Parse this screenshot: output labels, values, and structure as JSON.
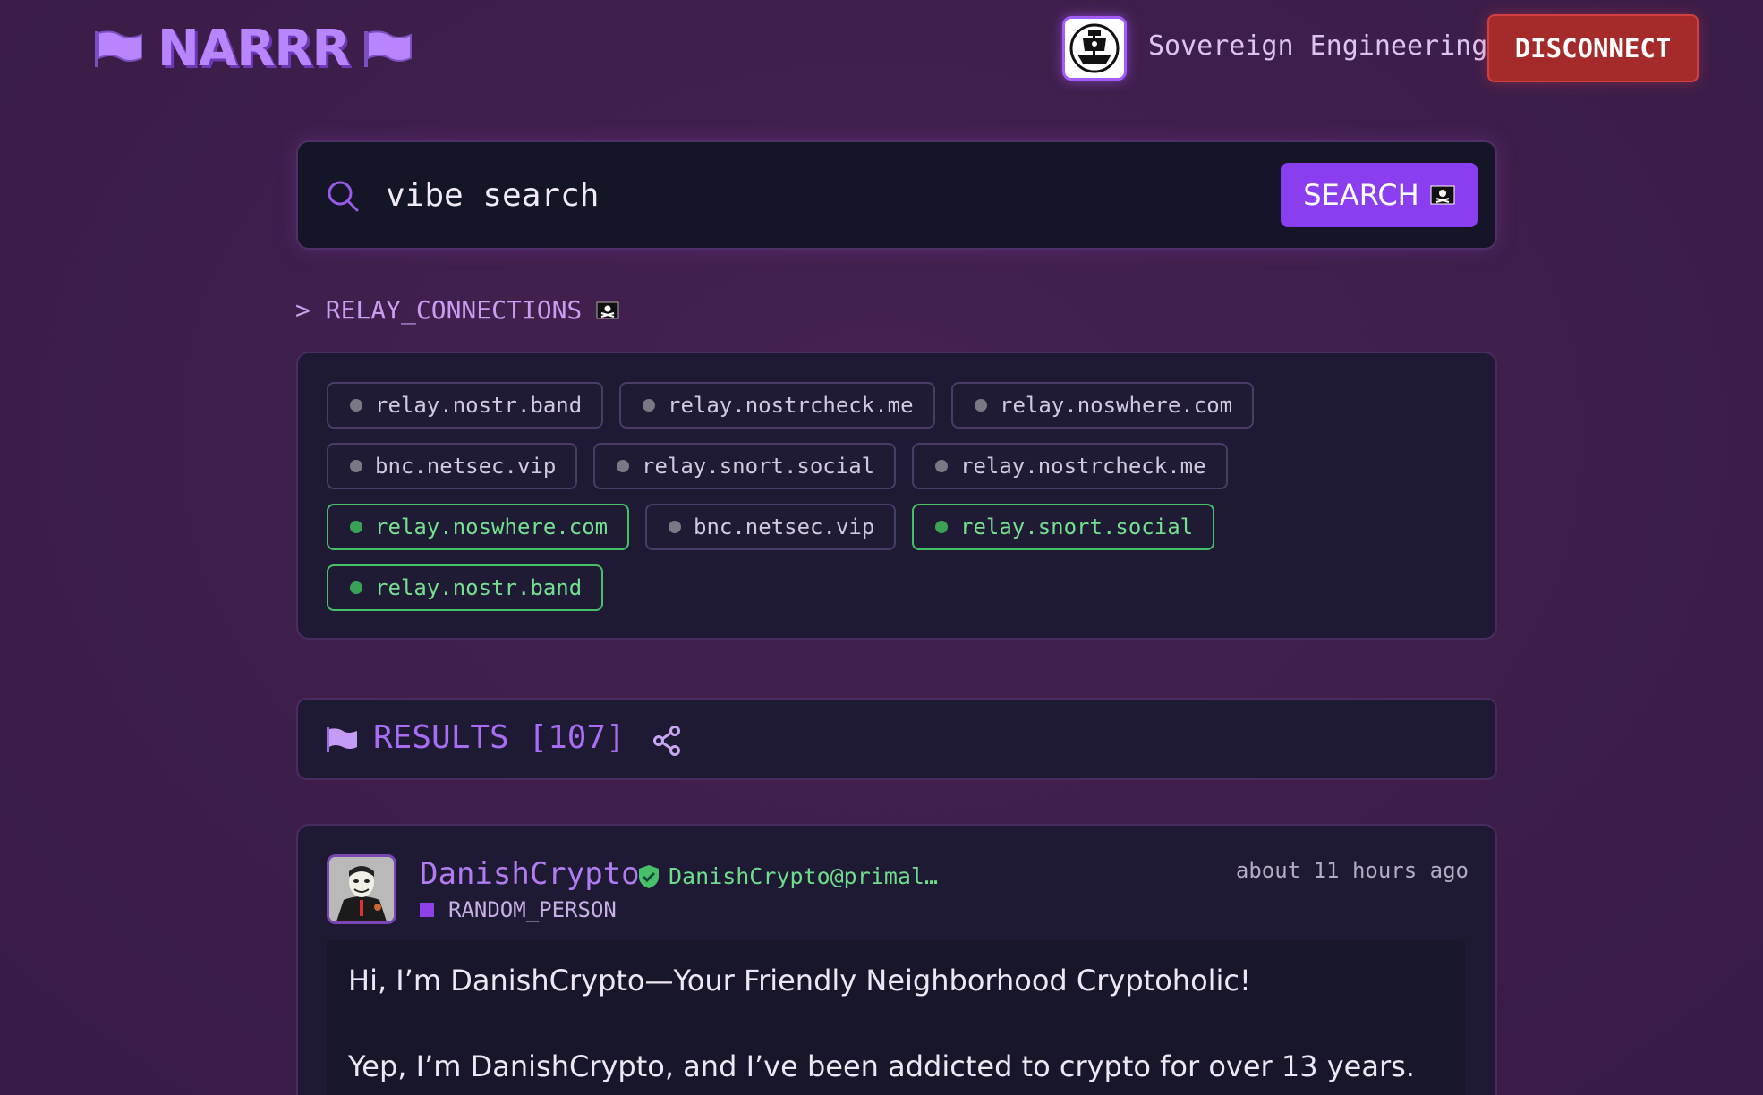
{
  "header": {
    "logo_text": "NARRR",
    "user_name": "Sovereign Engineering",
    "disconnect_label": "DISCONNECT",
    "flag_color": "#b985ff"
  },
  "search": {
    "value": "vibe search",
    "placeholder": "",
    "button_label": "SEARCH",
    "button_icon": "pirate-flag-icon"
  },
  "relays": {
    "heading": "> RELAY_CONNECTIONS",
    "items": [
      {
        "label": "relay.nostr.band",
        "active": false
      },
      {
        "label": "relay.nostrcheck.me",
        "active": false
      },
      {
        "label": "relay.noswhere.com",
        "active": false
      },
      {
        "label": "bnc.netsec.vip",
        "active": false
      },
      {
        "label": "relay.snort.social",
        "active": false
      },
      {
        "label": "relay.nostrcheck.me",
        "active": false
      },
      {
        "label": "relay.noswhere.com",
        "active": true
      },
      {
        "label": "bnc.netsec.vip",
        "active": false
      },
      {
        "label": "relay.snort.social",
        "active": true
      },
      {
        "label": "relay.nostr.band",
        "active": true
      }
    ]
  },
  "results": {
    "label": "RESULTS [107]"
  },
  "post": {
    "author": "DanishCrypto",
    "nip05": "DanishCrypto@primal…",
    "role": "RANDOM_PERSON",
    "timestamp": "about 11 hours ago",
    "lines": [
      "Hi, I’m DanishCrypto—Your Friendly Neighborhood Cryptoholic!",
      "Yep, I’m DanishCrypto, and I’ve been addicted to crypto for over 13 years."
    ]
  },
  "colors": {
    "accent": "#8a3ef0",
    "active_relay": "#45c267",
    "disconnect": "#a52a2a"
  }
}
